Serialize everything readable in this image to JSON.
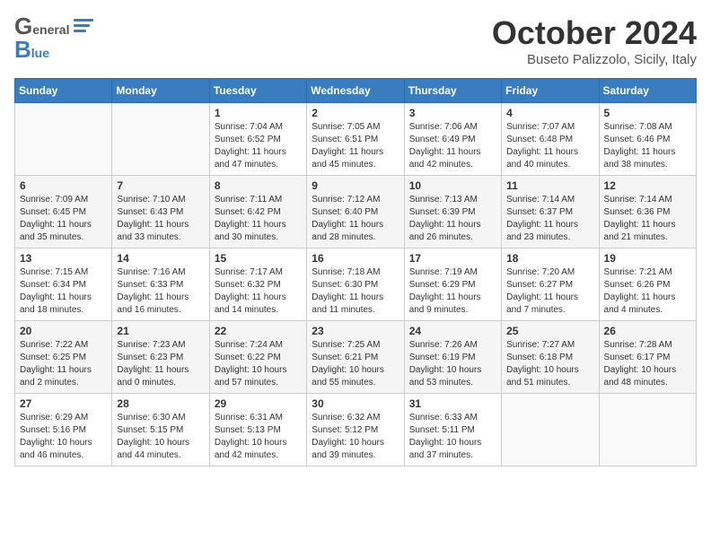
{
  "header": {
    "logo_general": "General",
    "logo_blue": "Blue",
    "month_title": "October 2024",
    "subtitle": "Buseto Palizzolo, Sicily, Italy"
  },
  "days_of_week": [
    "Sunday",
    "Monday",
    "Tuesday",
    "Wednesday",
    "Thursday",
    "Friday",
    "Saturday"
  ],
  "weeks": [
    [
      {
        "day": "",
        "info": ""
      },
      {
        "day": "",
        "info": ""
      },
      {
        "day": "1",
        "info": "Sunrise: 7:04 AM\nSunset: 6:52 PM\nDaylight: 11 hours and 47 minutes."
      },
      {
        "day": "2",
        "info": "Sunrise: 7:05 AM\nSunset: 6:51 PM\nDaylight: 11 hours and 45 minutes."
      },
      {
        "day": "3",
        "info": "Sunrise: 7:06 AM\nSunset: 6:49 PM\nDaylight: 11 hours and 42 minutes."
      },
      {
        "day": "4",
        "info": "Sunrise: 7:07 AM\nSunset: 6:48 PM\nDaylight: 11 hours and 40 minutes."
      },
      {
        "day": "5",
        "info": "Sunrise: 7:08 AM\nSunset: 6:46 PM\nDaylight: 11 hours and 38 minutes."
      }
    ],
    [
      {
        "day": "6",
        "info": "Sunrise: 7:09 AM\nSunset: 6:45 PM\nDaylight: 11 hours and 35 minutes."
      },
      {
        "day": "7",
        "info": "Sunrise: 7:10 AM\nSunset: 6:43 PM\nDaylight: 11 hours and 33 minutes."
      },
      {
        "day": "8",
        "info": "Sunrise: 7:11 AM\nSunset: 6:42 PM\nDaylight: 11 hours and 30 minutes."
      },
      {
        "day": "9",
        "info": "Sunrise: 7:12 AM\nSunset: 6:40 PM\nDaylight: 11 hours and 28 minutes."
      },
      {
        "day": "10",
        "info": "Sunrise: 7:13 AM\nSunset: 6:39 PM\nDaylight: 11 hours and 26 minutes."
      },
      {
        "day": "11",
        "info": "Sunrise: 7:14 AM\nSunset: 6:37 PM\nDaylight: 11 hours and 23 minutes."
      },
      {
        "day": "12",
        "info": "Sunrise: 7:14 AM\nSunset: 6:36 PM\nDaylight: 11 hours and 21 minutes."
      }
    ],
    [
      {
        "day": "13",
        "info": "Sunrise: 7:15 AM\nSunset: 6:34 PM\nDaylight: 11 hours and 18 minutes."
      },
      {
        "day": "14",
        "info": "Sunrise: 7:16 AM\nSunset: 6:33 PM\nDaylight: 11 hours and 16 minutes."
      },
      {
        "day": "15",
        "info": "Sunrise: 7:17 AM\nSunset: 6:32 PM\nDaylight: 11 hours and 14 minutes."
      },
      {
        "day": "16",
        "info": "Sunrise: 7:18 AM\nSunset: 6:30 PM\nDaylight: 11 hours and 11 minutes."
      },
      {
        "day": "17",
        "info": "Sunrise: 7:19 AM\nSunset: 6:29 PM\nDaylight: 11 hours and 9 minutes."
      },
      {
        "day": "18",
        "info": "Sunrise: 7:20 AM\nSunset: 6:27 PM\nDaylight: 11 hours and 7 minutes."
      },
      {
        "day": "19",
        "info": "Sunrise: 7:21 AM\nSunset: 6:26 PM\nDaylight: 11 hours and 4 minutes."
      }
    ],
    [
      {
        "day": "20",
        "info": "Sunrise: 7:22 AM\nSunset: 6:25 PM\nDaylight: 11 hours and 2 minutes."
      },
      {
        "day": "21",
        "info": "Sunrise: 7:23 AM\nSunset: 6:23 PM\nDaylight: 11 hours and 0 minutes."
      },
      {
        "day": "22",
        "info": "Sunrise: 7:24 AM\nSunset: 6:22 PM\nDaylight: 10 hours and 57 minutes."
      },
      {
        "day": "23",
        "info": "Sunrise: 7:25 AM\nSunset: 6:21 PM\nDaylight: 10 hours and 55 minutes."
      },
      {
        "day": "24",
        "info": "Sunrise: 7:26 AM\nSunset: 6:19 PM\nDaylight: 10 hours and 53 minutes."
      },
      {
        "day": "25",
        "info": "Sunrise: 7:27 AM\nSunset: 6:18 PM\nDaylight: 10 hours and 51 minutes."
      },
      {
        "day": "26",
        "info": "Sunrise: 7:28 AM\nSunset: 6:17 PM\nDaylight: 10 hours and 48 minutes."
      }
    ],
    [
      {
        "day": "27",
        "info": "Sunrise: 6:29 AM\nSunset: 5:16 PM\nDaylight: 10 hours and 46 minutes."
      },
      {
        "day": "28",
        "info": "Sunrise: 6:30 AM\nSunset: 5:15 PM\nDaylight: 10 hours and 44 minutes."
      },
      {
        "day": "29",
        "info": "Sunrise: 6:31 AM\nSunset: 5:13 PM\nDaylight: 10 hours and 42 minutes."
      },
      {
        "day": "30",
        "info": "Sunrise: 6:32 AM\nSunset: 5:12 PM\nDaylight: 10 hours and 39 minutes."
      },
      {
        "day": "31",
        "info": "Sunrise: 6:33 AM\nSunset: 5:11 PM\nDaylight: 10 hours and 37 minutes."
      },
      {
        "day": "",
        "info": ""
      },
      {
        "day": "",
        "info": ""
      }
    ]
  ]
}
